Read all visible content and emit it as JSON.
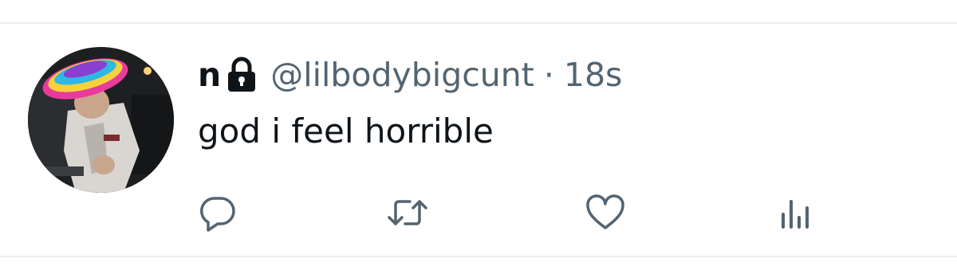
{
  "tweet": {
    "display_name": "n",
    "handle": "@lilbodybigcunt",
    "separator": "·",
    "timestamp": "18s",
    "text": "god i feel horrible",
    "protected": true
  },
  "icons": {
    "lock": "lock-icon",
    "reply": "reply-icon",
    "retweet": "retweet-icon",
    "like": "heart-icon",
    "views": "views-icon"
  },
  "colors": {
    "text_primary": "#0f1419",
    "text_secondary": "#536471",
    "divider": "#eceff1",
    "background": "#ffffff"
  }
}
